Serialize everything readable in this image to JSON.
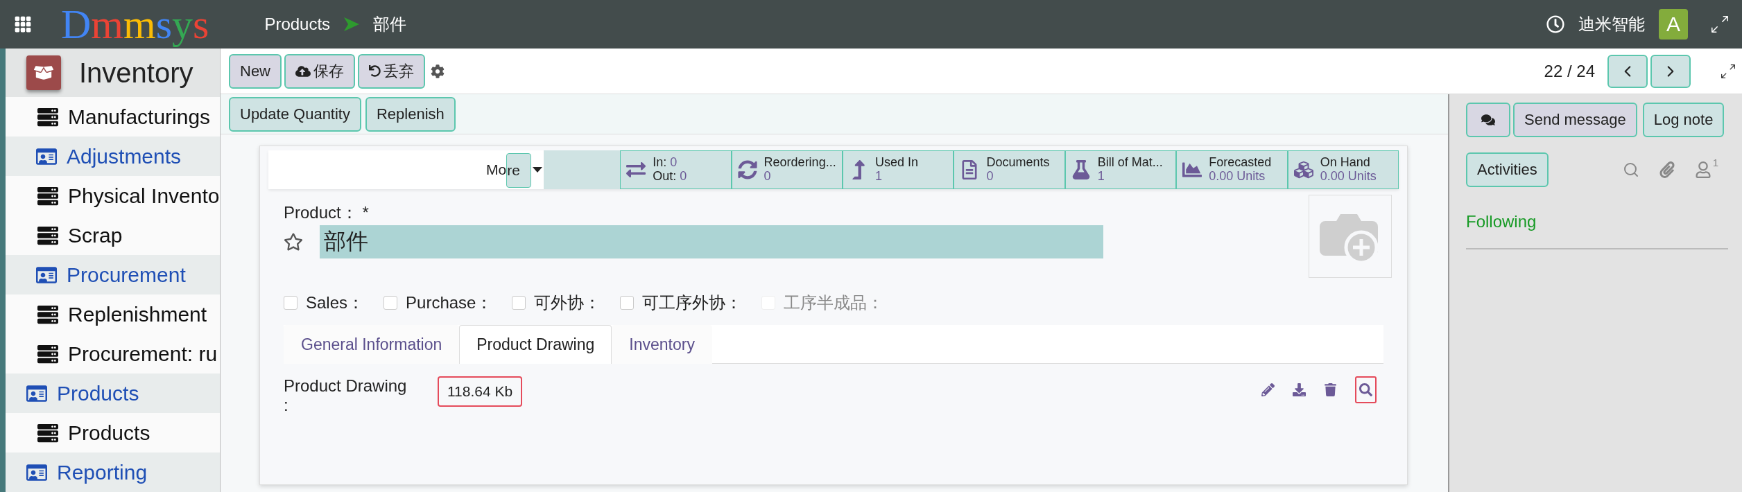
{
  "topbar": {
    "brand": "Dmmsys",
    "breadcrumb": [
      {
        "label": "Products"
      },
      {
        "label": "部件"
      }
    ],
    "company": "迪米智能",
    "avatar": "A"
  },
  "sidebar": {
    "app": "Inventory",
    "items": [
      {
        "kind": "item",
        "label": "Manufacturings"
      },
      {
        "kind": "section",
        "label": "Adjustments"
      },
      {
        "kind": "item",
        "label": "Physical Invento"
      },
      {
        "kind": "item",
        "label": "Scrap"
      },
      {
        "kind": "section",
        "label": "Procurement"
      },
      {
        "kind": "item",
        "label": "Replenishment"
      },
      {
        "kind": "item",
        "label": "Procurement: ru"
      },
      {
        "kind": "top",
        "label": "Products"
      },
      {
        "kind": "item",
        "label": "Products"
      },
      {
        "kind": "top",
        "label": "Reporting"
      }
    ]
  },
  "toolbar": {
    "new": "New",
    "save": "保存",
    "discard": "丢弃",
    "pager": "22 / 24",
    "actions": [
      "Update Quantity",
      "Replenish"
    ]
  },
  "stats": {
    "more": "More",
    "buttons": [
      {
        "kind": "inout",
        "lines": [
          {
            "label": "In:",
            "value": "0"
          },
          {
            "label": "Out:",
            "value": "0"
          }
        ]
      },
      {
        "kind": "reorder",
        "title": "Reordering...",
        "value": "0"
      },
      {
        "kind": "usedin",
        "title": "Used In",
        "value": "1"
      },
      {
        "kind": "documents",
        "title": "Documents",
        "value": "0"
      },
      {
        "kind": "bom",
        "title": "Bill of Mat...",
        "value": "1"
      },
      {
        "kind": "forecast",
        "title": "Forecasted",
        "value": "0.00 Units"
      },
      {
        "kind": "onhand",
        "title": "On Hand",
        "value": "0.00 Units"
      }
    ]
  },
  "form": {
    "product_label": "Product：",
    "required_mark": "*",
    "favorite": false,
    "name": "部件",
    "options": [
      {
        "label": "Sales：",
        "checked": false,
        "disabled": false
      },
      {
        "label": "Purchase：",
        "checked": false,
        "disabled": false
      },
      {
        "label": "可外协：",
        "checked": false,
        "disabled": false
      },
      {
        "label": "可工序外协：",
        "checked": false,
        "disabled": false
      },
      {
        "label": "工序半成品：",
        "checked": false,
        "disabled": true
      }
    ],
    "tabs": [
      {
        "label": "General Information",
        "selected": false
      },
      {
        "label": "Product Drawing",
        "selected": true
      },
      {
        "label": "Inventory",
        "selected": false
      }
    ],
    "drawing_label": "Product Drawing",
    "drawing_colon": ":",
    "file_size": "118.64 Kb"
  },
  "chatter": {
    "send": "Send message",
    "log": "Log note",
    "activities": "Activities",
    "followers": "1",
    "following": "Following"
  }
}
